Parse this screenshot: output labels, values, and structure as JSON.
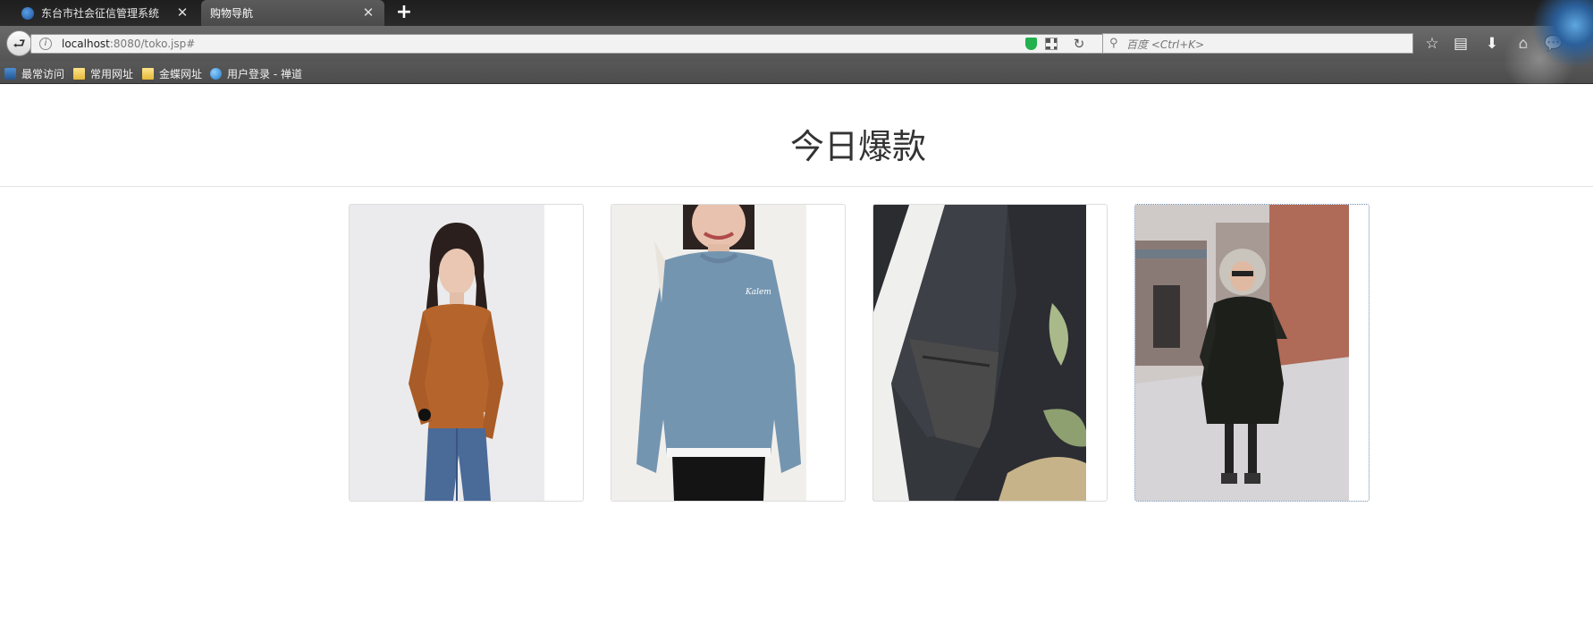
{
  "browser": {
    "tabs": [
      {
        "label": "东台市社会征信管理系统",
        "active": false
      },
      {
        "label": "购物导航",
        "active": true
      }
    ],
    "url": {
      "host": "localhost",
      "rest": ":8080/toko.jsp#"
    },
    "search_placeholder": "百度 <Ctrl+K>",
    "bookmarks": [
      {
        "label": "最常访问",
        "icon": "recent-icon"
      },
      {
        "label": "常用网址",
        "icon": "folder-icon"
      },
      {
        "label": "金蝶网址",
        "icon": "folder-icon"
      },
      {
        "label": "用户登录 - 禅道",
        "icon": "globe-icon"
      }
    ]
  },
  "page": {
    "title": "今日爆款",
    "products": [
      {
        "image": "woman in rust ribbed turtleneck sweater and jeans"
      },
      {
        "image": "woman in blue oversized sweatshirt"
      },
      {
        "image": "close-up of dark fleece-lined leggings"
      },
      {
        "image": "woman in black parka with fur hood on street"
      }
    ]
  },
  "colors": {
    "title": "#333333",
    "card_border": "#dddddd",
    "divider": "#e3e3e3"
  }
}
